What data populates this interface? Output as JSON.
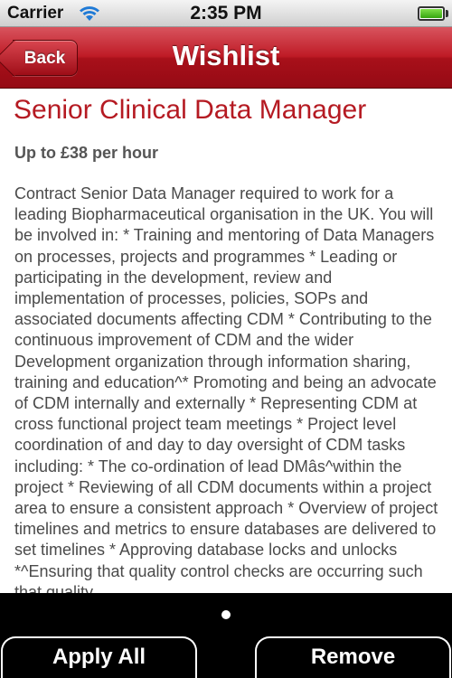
{
  "status_bar": {
    "carrier": "Carrier",
    "time": "2:35 PM",
    "wifi_icon": "wifi-icon",
    "battery_icon": "battery-full-icon"
  },
  "nav": {
    "title": "Wishlist",
    "back_label": "Back",
    "color": "#bf1b26"
  },
  "job": {
    "title": "Senior Clinical Data Manager",
    "rate": "Up to £38 per hour",
    "description": "Contract Senior Data Manager required to work for a leading Biopharmaceutical organisation in the UK. You will be involved in: * Training and mentoring of Data Managers on processes, projects and programmes * Leading or participating in the development, review and implementation of processes, policies, SOPs and associated documents affecting CDM * Contributing to the continuous improvement of CDM and the wider Development organization through information sharing, training and education^* Promoting and being an advocate of CDM internally and externally * Representing CDM at cross functional project team meetings * Project level coordination of and day to day oversight of CDM tasks including: * The co-ordination of lead DMâs^within the project * Reviewing of all CDM documents within a project area to ensure a consistent approach * Overview of project timelines and metrics to ensure databases are delivered to set timelines * Approving database locks and unlocks *^Ensuring that quality control checks are occurring such that quality",
    "title_color": "#b51a22"
  },
  "bottom_bar": {
    "apply_all_label": "Apply All",
    "remove_label": "Remove",
    "page_indicator": {
      "pages": 1,
      "current": 1
    }
  }
}
